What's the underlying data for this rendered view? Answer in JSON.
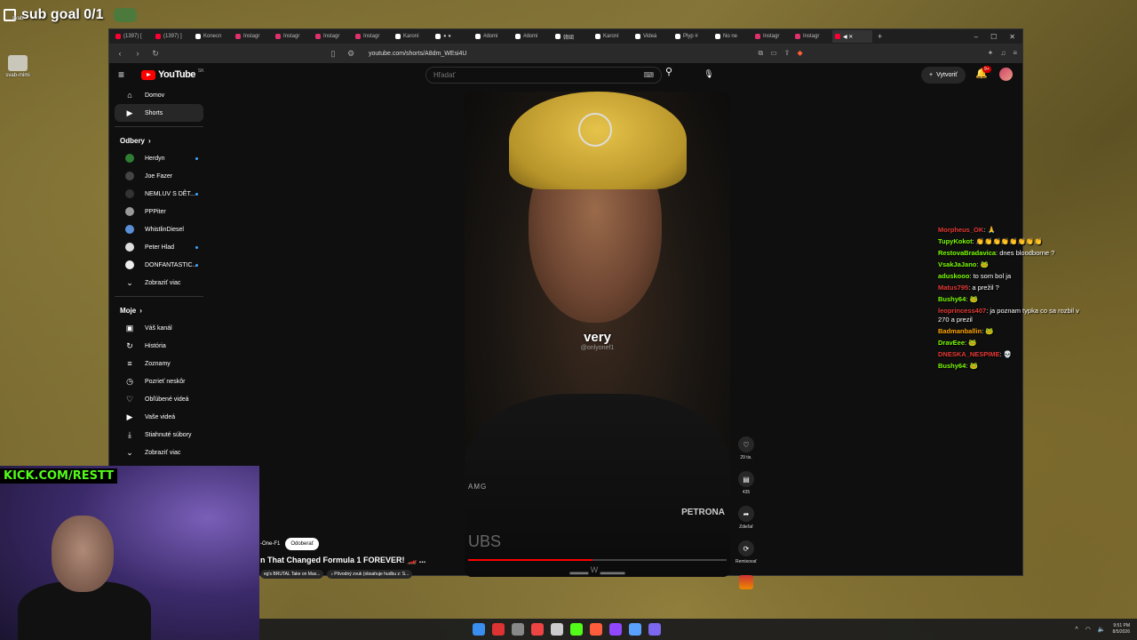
{
  "overlay": {
    "goal_text": "sub goal 0/1",
    "desktop_icons": [
      {
        "label": "svab"
      },
      {
        "label": "svab-mimi"
      }
    ],
    "kick_banner": "KICK.COM/RESTT"
  },
  "browser": {
    "tabs": [
      {
        "label": "(1397) [",
        "color": "#ff0033"
      },
      {
        "label": "(1397) ]",
        "color": "#ff0033"
      },
      {
        "label": "Konecn",
        "color": "#ffffff"
      },
      {
        "label": "Instagr",
        "color": "#e1306c"
      },
      {
        "label": "Instagr",
        "color": "#e1306c"
      },
      {
        "label": "Instagr",
        "color": "#e1306c"
      },
      {
        "label": "Instagr",
        "color": "#e1306c"
      },
      {
        "label": "Karoní",
        "color": "#ffffff"
      },
      {
        "label": "● ●",
        "color": "#ffffff"
      },
      {
        "label": "#domi",
        "color": "#ffffff"
      },
      {
        "label": "#domi",
        "color": "#ffffff"
      },
      {
        "label": "韓國",
        "color": "#ffffff"
      },
      {
        "label": "Karoní",
        "color": "#ffffff"
      },
      {
        "label": "Videá",
        "color": "#ffffff"
      },
      {
        "label": "Plyp #",
        "color": "#ffffff"
      },
      {
        "label": "No ne",
        "color": "#ffffff"
      },
      {
        "label": "Instagr",
        "color": "#e1306c"
      },
      {
        "label": "Instagr",
        "color": "#e1306c"
      },
      {
        "label": "◀ ✕",
        "color": "#ff0033",
        "active": true
      }
    ],
    "new_tab": "+",
    "url": "youtube.com/shorts/A8dm_WEsi4U"
  },
  "youtube": {
    "logo_text": "YouTube",
    "region": "SK",
    "search_placeholder": "Hľadať",
    "create_label": "Vytvoriť",
    "notif_count": "9+",
    "nav": [
      {
        "label": "Domov",
        "icon": "home-icon",
        "glyph": "⌂"
      },
      {
        "label": "Shorts",
        "icon": "shorts-icon",
        "glyph": "▶",
        "active": true
      }
    ],
    "subs_heading": "Odbery",
    "subscriptions": [
      {
        "label": "Herdyn",
        "color": "#2e7d32",
        "dot": true
      },
      {
        "label": "Joe Fazer",
        "color": "#444444",
        "dot": false
      },
      {
        "label": "NEMLUV S DĚT...",
        "color": "#333333",
        "dot": true
      },
      {
        "label": "PPPiter",
        "color": "#999999",
        "dot": false
      },
      {
        "label": "WhistlinDiesel",
        "color": "#5a8fd8",
        "dot": false
      },
      {
        "label": "Peter Hlad",
        "color": "#dddddd",
        "dot": true
      },
      {
        "label": "DONFANTASTIC...",
        "color": "#eeeeee",
        "dot": true
      }
    ],
    "subs_more": "Zobraziť viac",
    "you_heading": "Moje",
    "you_items": [
      {
        "label": "Váš kanál",
        "glyph": "▣"
      },
      {
        "label": "História",
        "glyph": "↻"
      },
      {
        "label": "Zoznamy",
        "glyph": "≡"
      },
      {
        "label": "Pozrieť neskôr",
        "glyph": "◷"
      },
      {
        "label": "Obľúbené videá",
        "glyph": "♡"
      },
      {
        "label": "Vaše videá",
        "glyph": "▶"
      },
      {
        "label": "Stiahnuté súbory",
        "glyph": "⤓"
      }
    ],
    "you_more": "Zobraziť viac",
    "short": {
      "subtitle": "very",
      "watermark": "@onlyonef1",
      "channel": "-One-F1",
      "subscribe": "Odoberať",
      "title": "n That Changed Formula 1 FOREVER! 🏎️ ...",
      "chips": [
        "eg's BRUTAL Take on Max...",
        "♪ Pôvodný zvuk (obsahuje hudbu z: S..."
      ],
      "likes": "29 tis.",
      "comments": "435",
      "share": "Zdieľať",
      "remix": "Remixovať",
      "caption_strip": "▂▂▂ W ▂▂▂▂",
      "sponsor_amg": "AMG",
      "sponsor_ubs": "UBS",
      "sponsor_petronas": "PETRONA",
      "progress": 0.48
    }
  },
  "chat": [
    {
      "user": "Morpheus_OK",
      "color": "#e53935",
      "text": "🙏"
    },
    {
      "user": "TupyKokot",
      "color": "#7cfc00",
      "text": "👏👏👏👏👏👏👏👏"
    },
    {
      "user": "RestovaBradavica",
      "color": "#7cfc00",
      "text": "dnes bloodborne ?"
    },
    {
      "user": "VsakJaJano",
      "color": "#7cfc00",
      "text": "🐸"
    },
    {
      "user": "aduskooo",
      "color": "#7cfc00",
      "text": "to som bol ja"
    },
    {
      "user": "Matus795",
      "color": "#e53935",
      "text": "a prežil ?"
    },
    {
      "user": "Bushy64",
      "color": "#7cfc00",
      "text": "🐸"
    },
    {
      "user": "leoprincess407",
      "color": "#e53935",
      "text": "ja poznam typka co sa rozbil v 270 a prezil"
    },
    {
      "user": "Badmanballin",
      "color": "#ffa500",
      "text": "🐸"
    },
    {
      "user": "DravEee",
      "color": "#7cfc00",
      "text": "🐸"
    },
    {
      "user": "DNESKA_NESPIME",
      "color": "#e53935",
      "text": "💀"
    },
    {
      "user": "Bushy64",
      "color": "#7cfc00",
      "text": "🐸"
    }
  ],
  "taskbar": {
    "apps": [
      "#3a8ef0",
      "#d33",
      "#888",
      "#e44",
      "#ccc",
      "#53fc18",
      "#ff5d3b",
      "#9147ff",
      "#5aa0ff",
      "#7b68ee"
    ],
    "time": "9:51 PM",
    "date": "8/5/2026"
  },
  "colors": {
    "accent": "#ff0000",
    "kick": "#53fc18",
    "link": "#3ea6ff"
  }
}
